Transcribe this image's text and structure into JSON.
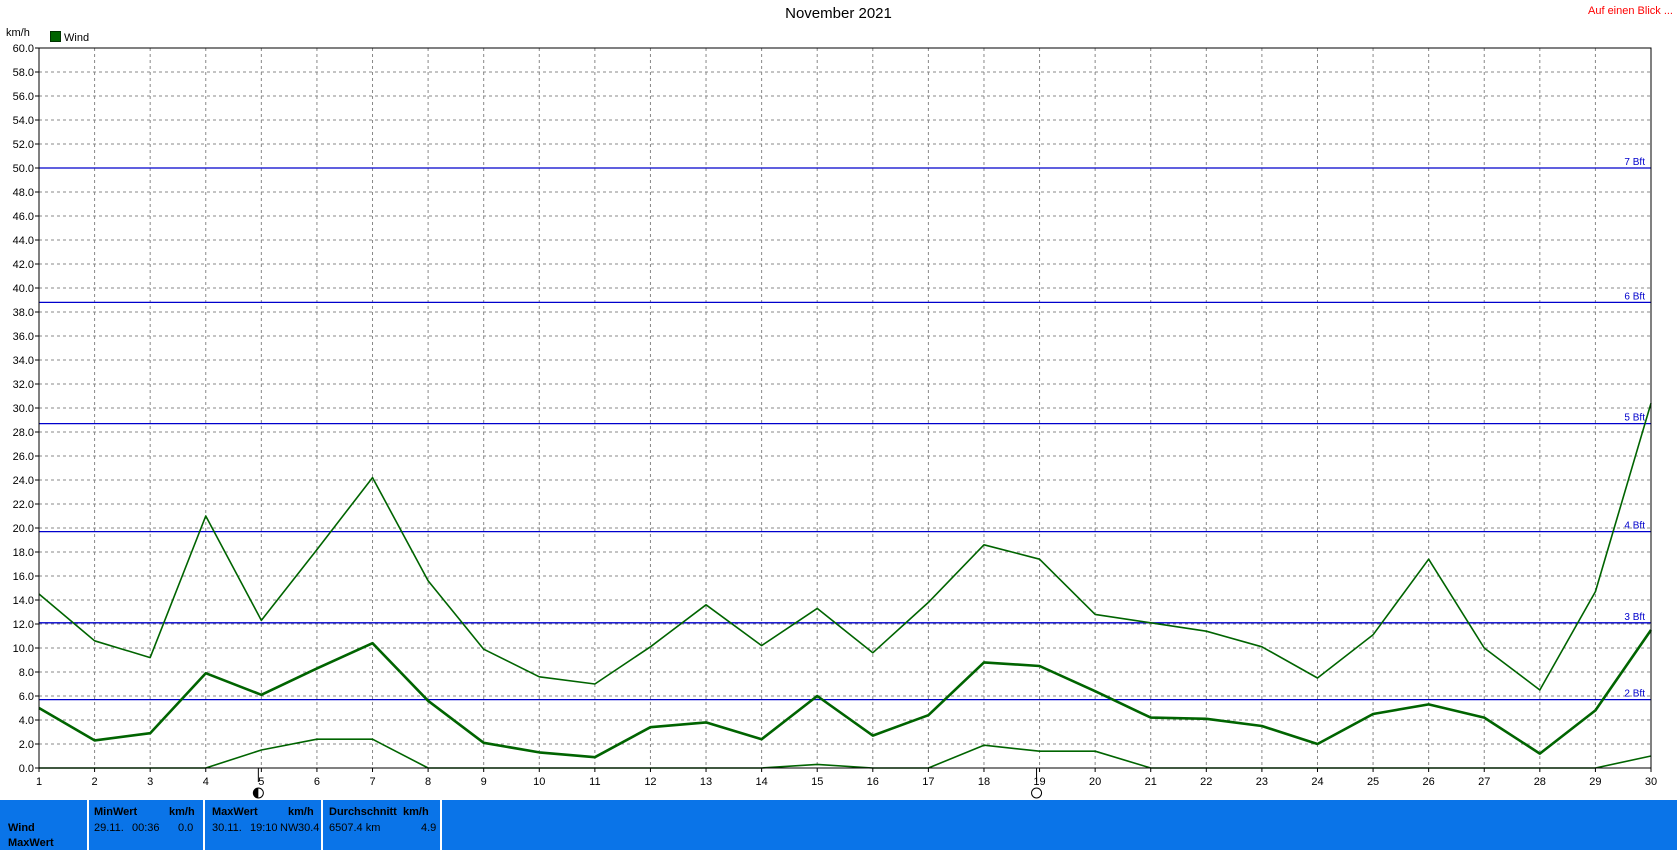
{
  "header": {
    "title": "November 2021",
    "link": "Auf einen Blick ..."
  },
  "chart_data": {
    "type": "line",
    "title": "November 2021",
    "ylabel": "km/h",
    "xlabel": "",
    "ylim": [
      0,
      60
    ],
    "xlim": [
      1,
      30
    ],
    "x": [
      1,
      2,
      3,
      4,
      5,
      6,
      7,
      8,
      9,
      10,
      11,
      12,
      13,
      14,
      15,
      16,
      17,
      18,
      19,
      20,
      21,
      22,
      23,
      24,
      25,
      26,
      27,
      28,
      29,
      30
    ],
    "y_ticks": [
      "0.0",
      "2.0",
      "4.0",
      "6.0",
      "8.0",
      "10.0",
      "12.0",
      "14.0",
      "16.0",
      "18.0",
      "20.0",
      "22.0",
      "24.0",
      "26.0",
      "28.0",
      "30.0",
      "32.0",
      "34.0",
      "36.0",
      "38.0",
      "40.0",
      "42.0",
      "44.0",
      "46.0",
      "48.0",
      "50.0",
      "52.0",
      "54.0",
      "56.0",
      "58.0",
      "60.0"
    ],
    "x_ticks": [
      "1",
      "2",
      "3",
      "4",
      "5",
      "6",
      "7",
      "8",
      "9",
      "10",
      "11",
      "12",
      "13",
      "14",
      "15",
      "16",
      "17",
      "18",
      "19",
      "20",
      "21",
      "22",
      "23",
      "24",
      "25",
      "26",
      "27",
      "28",
      "29",
      "30"
    ],
    "legend": [
      "Wind"
    ],
    "legend_position": "top-left",
    "grid": true,
    "series": [
      {
        "name": "Wind",
        "role": "max",
        "color": "#006400",
        "values": [
          14.5,
          10.6,
          9.2,
          21.0,
          12.3,
          18.2,
          24.2,
          15.6,
          9.9,
          7.6,
          7.0,
          10.1,
          13.6,
          10.2,
          13.3,
          9.6,
          13.8,
          18.6,
          17.4,
          12.8,
          12.1,
          11.4,
          10.1,
          7.5,
          11.1,
          17.4,
          10.0,
          6.5,
          14.7,
          30.4
        ]
      },
      {
        "name": "Wind",
        "role": "avg",
        "color": "#006400",
        "values": [
          5.0,
          2.3,
          2.9,
          7.9,
          6.1,
          8.3,
          10.4,
          5.6,
          2.1,
          1.3,
          0.9,
          3.4,
          3.8,
          2.4,
          6.0,
          2.7,
          4.4,
          8.8,
          8.5,
          6.4,
          4.2,
          4.1,
          3.5,
          2.0,
          4.5,
          5.3,
          4.2,
          1.2,
          4.8,
          11.5
        ]
      },
      {
        "name": "Wind",
        "role": "min",
        "color": "#006400",
        "values": [
          0.0,
          0.0,
          0.0,
          0.0,
          1.5,
          2.4,
          2.4,
          0.0,
          0.0,
          0.0,
          0.0,
          0.0,
          0.0,
          0.0,
          0.3,
          0.0,
          0.0,
          1.9,
          1.4,
          1.4,
          0.0,
          0.0,
          0.0,
          0.0,
          0.0,
          0.0,
          0.0,
          0.0,
          0.0,
          1.0
        ]
      }
    ],
    "reference_lines": [
      {
        "label": "2 Bft",
        "value": 5.7
      },
      {
        "label": "3 Bft",
        "value": 12.1
      },
      {
        "label": "4 Bft",
        "value": 19.7
      },
      {
        "label": "5 Bft",
        "value": 28.7
      },
      {
        "label": "6 Bft",
        "value": 38.8
      },
      {
        "label": "7 Bft",
        "value": 50.0
      }
    ],
    "moon_phases": [
      {
        "day": 5,
        "phase": "half"
      },
      {
        "day": 19,
        "phase": "full"
      }
    ],
    "colors": {
      "series": "#006400",
      "reference": "#0000cc",
      "grid": "#888888"
    }
  },
  "stats": {
    "row_labels": [
      "Wind",
      "MaxWert"
    ],
    "min": {
      "header": "MinWert",
      "unit": "km/h",
      "date": "29.11.",
      "time": "00:36",
      "value": "0.0"
    },
    "max": {
      "header": "MaxWert",
      "unit": "km/h",
      "date": "30.11.",
      "time": "19:10",
      "dir": "NW",
      "value": "30.4"
    },
    "avg": {
      "header": "Durchschnitt",
      "unit": "km/h",
      "distance": "6507.4 km",
      "value": "4.9"
    }
  }
}
